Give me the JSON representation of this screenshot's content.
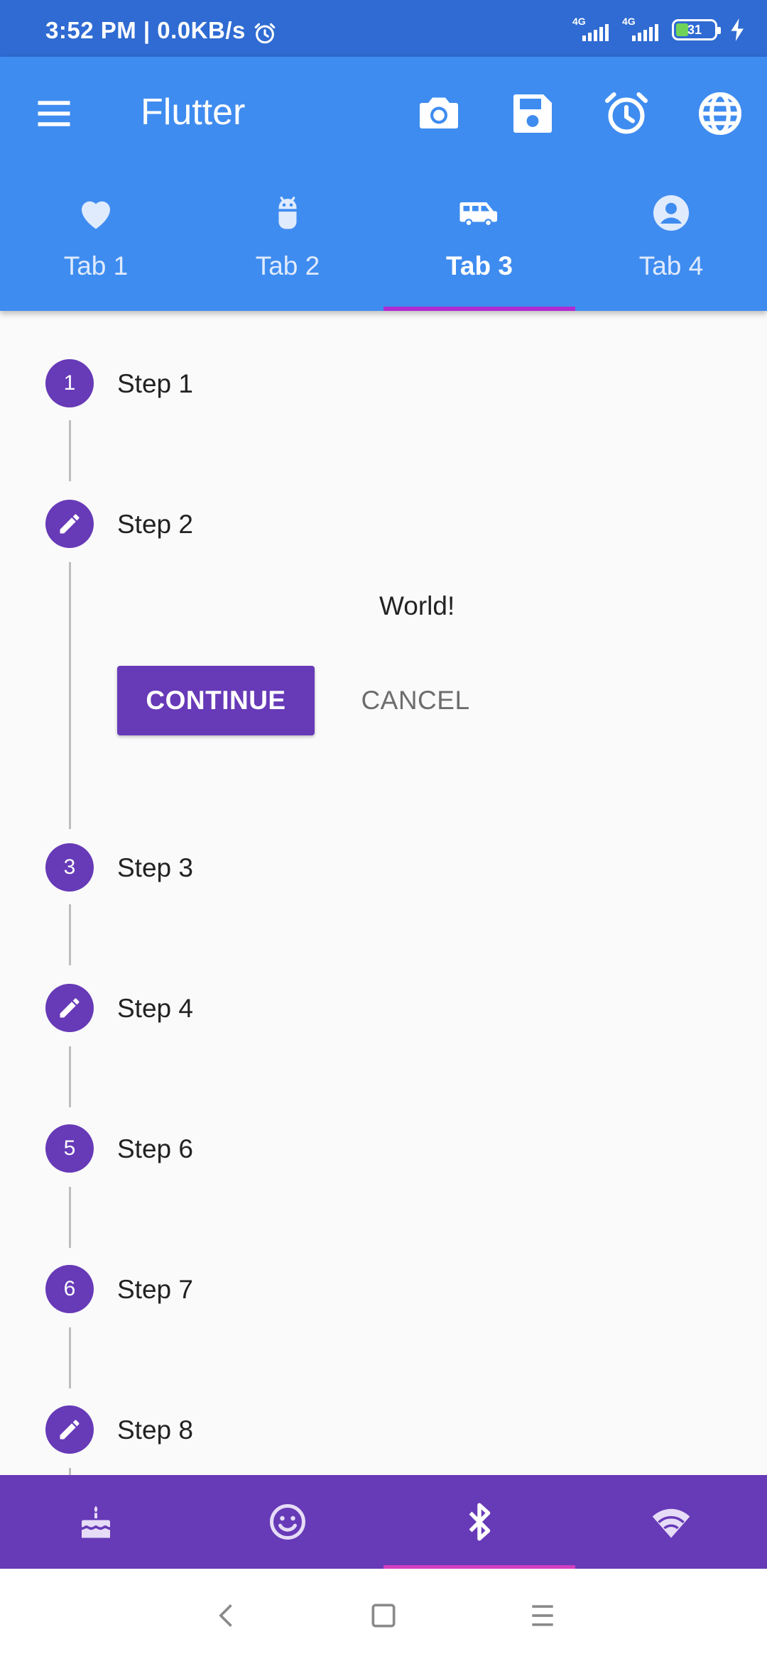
{
  "status_bar": {
    "time_speed": "3:52 PM | 0.0KB/s",
    "network_1": "4G",
    "network_2": "4G",
    "battery": "31"
  },
  "app_bar": {
    "title": "Flutter",
    "actions": [
      "camera-icon",
      "save-icon",
      "alarm-icon",
      "globe-icon"
    ],
    "color": "#3f8cf0"
  },
  "tabs": [
    {
      "label": "Tab 1",
      "icon": "heart-icon"
    },
    {
      "label": "Tab 2",
      "icon": "android-icon"
    },
    {
      "label": "Tab 3",
      "icon": "van-icon",
      "active": true
    },
    {
      "label": "Tab 4",
      "icon": "account-icon"
    }
  ],
  "stepper": {
    "accent": "#673ab7",
    "steps": [
      {
        "marker": "1",
        "label": "Step 1"
      },
      {
        "marker": "edit-icon",
        "label": "Step 2",
        "active": true
      },
      {
        "marker": "3",
        "label": "Step 3"
      },
      {
        "marker": "edit-icon",
        "label": "Step 4"
      },
      {
        "marker": "5",
        "label": "Step 6"
      },
      {
        "marker": "6",
        "label": "Step 7"
      },
      {
        "marker": "edit-icon",
        "label": "Step 8"
      }
    ],
    "content_text": "World!",
    "continue_label": "CONTINUE",
    "cancel_label": "CANCEL"
  },
  "bottom_nav": {
    "color": "#673ab7",
    "items": [
      "cake-icon",
      "smiley-icon",
      "bluetooth-icon",
      "wifi-icon"
    ],
    "active_index": 2
  },
  "system_nav": [
    "back-icon",
    "home-icon",
    "recents-icon"
  ]
}
